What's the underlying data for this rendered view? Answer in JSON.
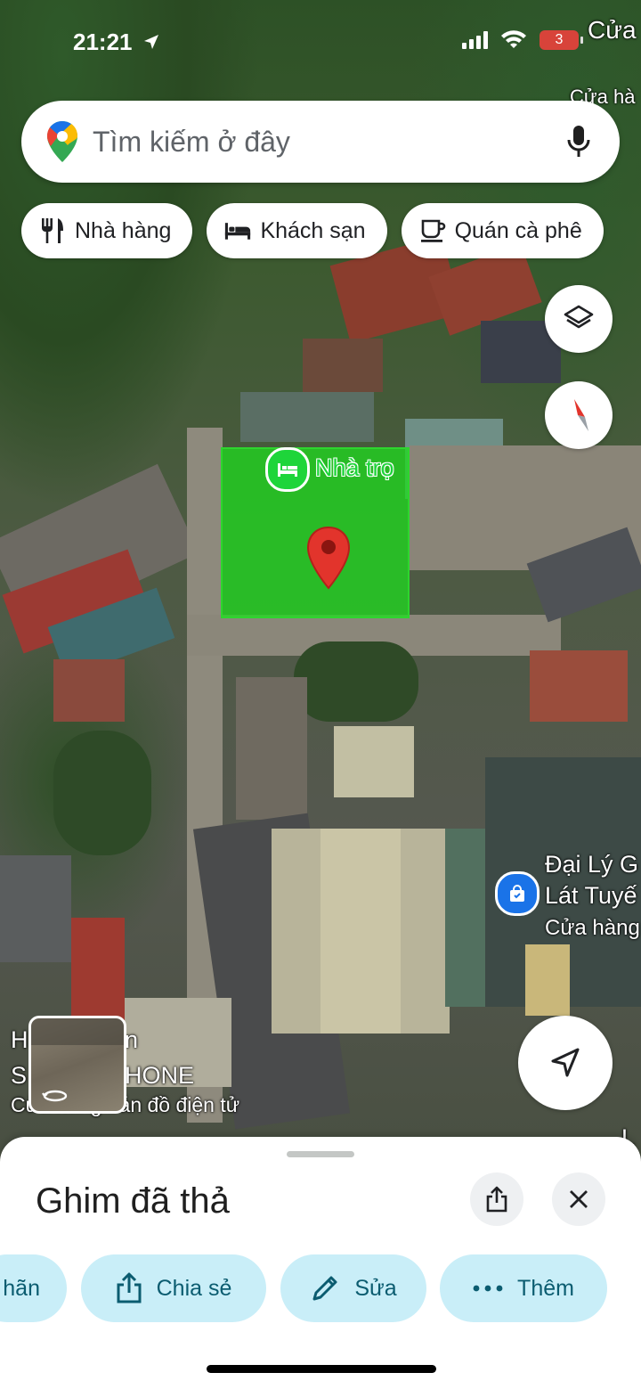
{
  "status_bar": {
    "time": "21:21",
    "battery": "3"
  },
  "map_labels": {
    "top_right_1": "Cửa",
    "top_right_2": "Cửa hà",
    "pin_place": "Nhà trọ",
    "right_place_line1": "Đại Lý G",
    "right_place_line2": "Lát Tuyế",
    "right_place_cat": "Cửa hàng",
    "left_place_line1": "H",
    "left_place_line1b": "n",
    "left_place_line2": "S",
    "left_place_line2b": "HONE",
    "left_place_cat": "Cửa hàng bán đồ điện tử",
    "edge_right": "L"
  },
  "search": {
    "placeholder": "Tìm kiếm ở đây"
  },
  "chips": [
    {
      "label": "Nhà hàng",
      "icon": "fork-knife-icon"
    },
    {
      "label": "Khách sạn",
      "icon": "bed-icon"
    },
    {
      "label": "Quán cà phê",
      "icon": "coffee-cup-icon"
    }
  ],
  "sheet": {
    "title": "Ghim đã thả",
    "actions": [
      {
        "label": "hãn",
        "icon": "label-icon"
      },
      {
        "label": "Chia sẻ",
        "icon": "share-icon"
      },
      {
        "label": "Sửa",
        "icon": "pencil-icon"
      },
      {
        "label": "Thêm",
        "icon": "more-dots-icon"
      }
    ]
  },
  "colors": {
    "accent": "#0b5c70",
    "action_bg": "#c9eef8",
    "pin_red": "#e2342c",
    "plot_green": "#1edc1e"
  }
}
